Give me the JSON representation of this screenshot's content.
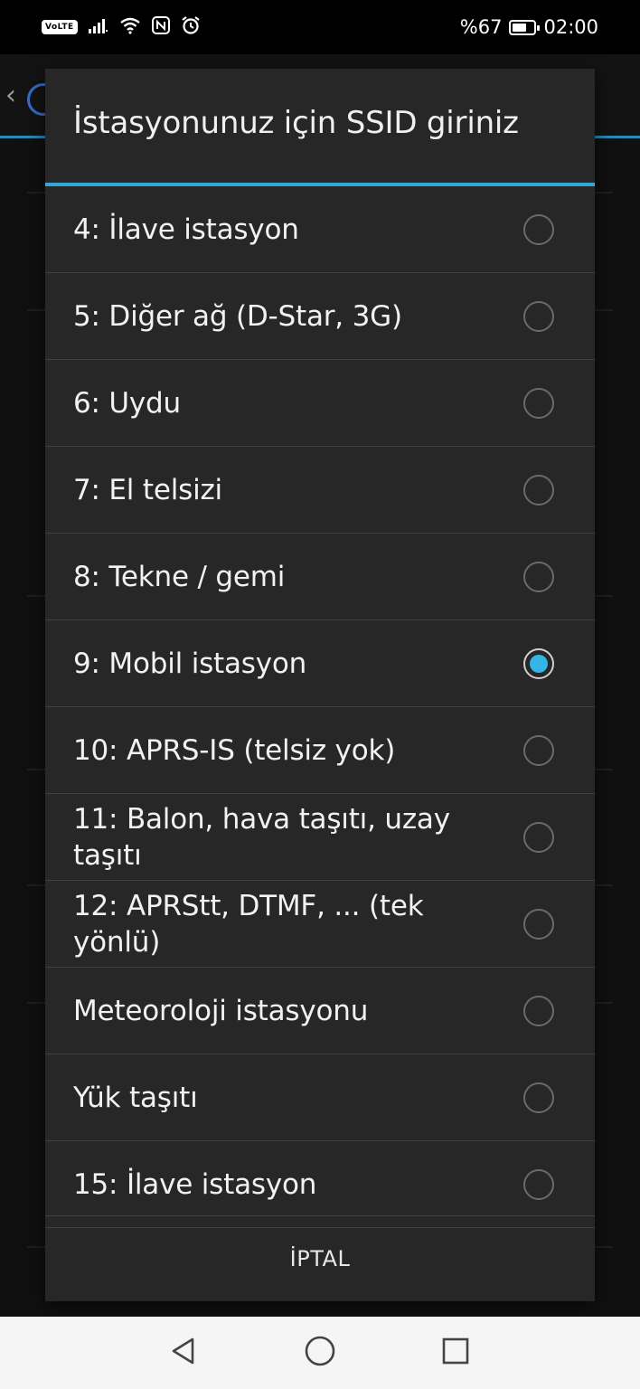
{
  "status_bar": {
    "network_badge": "VoLTE",
    "battery_text": "%67",
    "battery_level": 0.67,
    "time": "02:00"
  },
  "dialog": {
    "title": "İstasyonunuz için SSID giriniz",
    "options": [
      {
        "label": "4: İlave istasyon",
        "selected": false
      },
      {
        "label": "5: Diğer ağ (D-Star, 3G)",
        "selected": false
      },
      {
        "label": "6: Uydu",
        "selected": false
      },
      {
        "label": "7: El telsizi",
        "selected": false
      },
      {
        "label": "8: Tekne / gemi",
        "selected": false
      },
      {
        "label": "9: Mobil istasyon",
        "selected": true
      },
      {
        "label": "10: APRS-IS (telsiz yok)",
        "selected": false
      },
      {
        "label": "11: Balon, hava taşıtı, uzay taşıtı",
        "selected": false
      },
      {
        "label": "12: APRStt, DTMF, ... (tek yönlü)",
        "selected": false
      },
      {
        "label": "Meteoroloji istasyonu",
        "selected": false
      },
      {
        "label": "Yük taşıtı",
        "selected": false
      },
      {
        "label": "15: İlave istasyon",
        "selected": false
      }
    ],
    "cancel_label": "İPTAL"
  },
  "colors": {
    "accent": "#33b5e5",
    "dialog_bg": "#272727",
    "divider": "#3f3f3f"
  },
  "icons": {
    "nav_back": "triangle-back-icon",
    "nav_home": "circle-home-icon",
    "nav_recents": "square-recents-icon"
  }
}
